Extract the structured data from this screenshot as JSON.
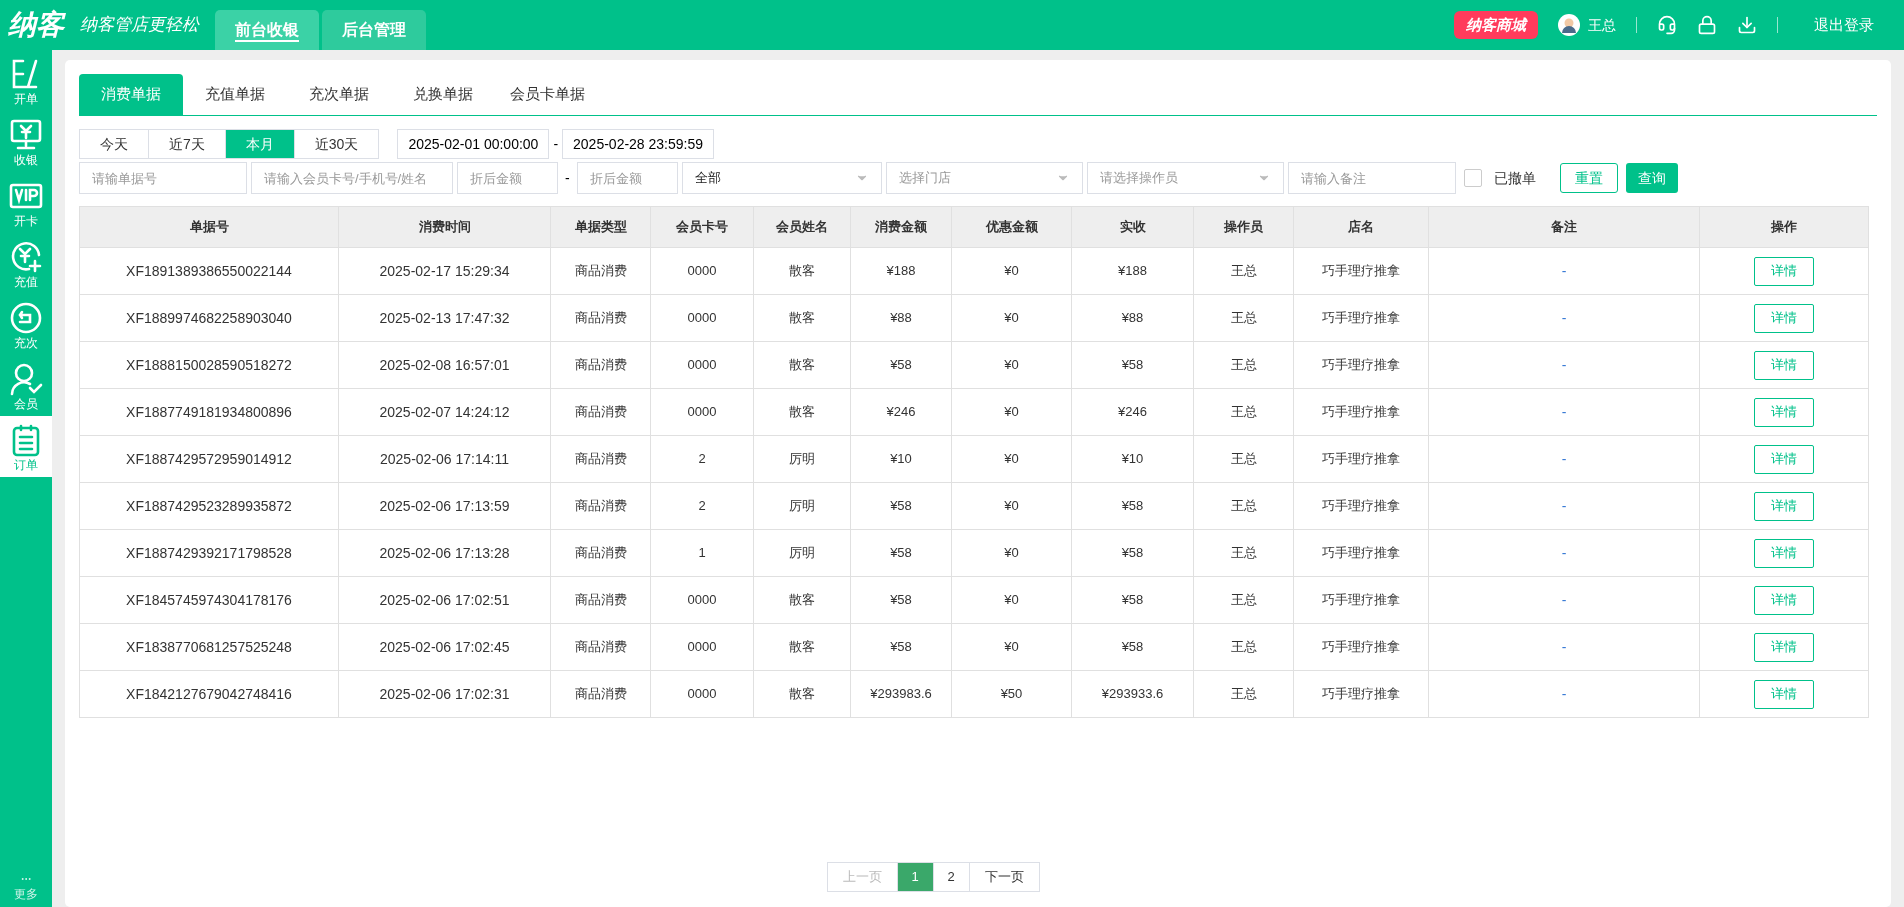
{
  "header": {
    "logo": "纳客",
    "slogan": "纳客管店更轻松",
    "nav": [
      {
        "label": "前台收银",
        "selected": true
      },
      {
        "label": "后台管理",
        "selected": false
      }
    ],
    "mall": "纳客商城",
    "user": "王总",
    "logout": "退出登录"
  },
  "sidebar": {
    "items": [
      {
        "label": "开单",
        "selected": false
      },
      {
        "label": "收银",
        "selected": false
      },
      {
        "label": "开卡",
        "selected": false
      },
      {
        "label": "充值",
        "selected": false
      },
      {
        "label": "充次",
        "selected": false
      },
      {
        "label": "会员",
        "selected": false
      },
      {
        "label": "订单",
        "selected": true
      }
    ],
    "more": "更多"
  },
  "tabs": [
    {
      "label": "消费单据",
      "selected": true
    },
    {
      "label": "充值单据",
      "selected": false
    },
    {
      "label": "充次单据",
      "selected": false
    },
    {
      "label": "兑换单据",
      "selected": false
    },
    {
      "label": "会员卡单据",
      "selected": false
    }
  ],
  "ranges": [
    {
      "label": "今天",
      "selected": false
    },
    {
      "label": "近7天",
      "selected": false
    },
    {
      "label": "本月",
      "selected": true
    },
    {
      "label": "近30天",
      "selected": false
    }
  ],
  "date_from": "2025-02-01 00:00:00",
  "date_sep": "-",
  "date_to": "2025-02-28 23:59:59",
  "filters": {
    "bill_no": {
      "placeholder": "请输单据号"
    },
    "member": {
      "placeholder": "请输入会员卡号/手机号/姓名"
    },
    "min_amount": {
      "placeholder": "折后金额"
    },
    "amount_sep": "-",
    "max_amount": {
      "placeholder": "折后金额"
    },
    "type": {
      "value": "全部"
    },
    "store": {
      "placeholder": "选择门店"
    },
    "operator": {
      "placeholder": "请选择操作员"
    },
    "note": {
      "placeholder": "请输入备注"
    },
    "revoked": {
      "label": "已撤单",
      "checked": false
    },
    "reset": "重置",
    "query": "查询"
  },
  "table": {
    "columns": [
      "单据号",
      "消费时间",
      "单据类型",
      "会员卡号",
      "会员姓名",
      "消费金额",
      "优惠金额",
      "实收",
      "操作员",
      "店名",
      "备注",
      "操作"
    ],
    "rows": [
      [
        "XF1891389386550022144",
        "2025-02-17 15:29:34",
        "商品消费",
        "0000",
        "散客",
        "¥188",
        "¥0",
        "¥188",
        "王总",
        "巧手理疗推拿",
        "-",
        "详情"
      ],
      [
        "XF1889974682258903040",
        "2025-02-13 17:47:32",
        "商品消费",
        "0000",
        "散客",
        "¥88",
        "¥0",
        "¥88",
        "王总",
        "巧手理疗推拿",
        "-",
        "详情"
      ],
      [
        "XF1888150028590518272",
        "2025-02-08 16:57:01",
        "商品消费",
        "0000",
        "散客",
        "¥58",
        "¥0",
        "¥58",
        "王总",
        "巧手理疗推拿",
        "-",
        "详情"
      ],
      [
        "XF1887749181934800896",
        "2025-02-07 14:24:12",
        "商品消费",
        "0000",
        "散客",
        "¥246",
        "¥0",
        "¥246",
        "王总",
        "巧手理疗推拿",
        "-",
        "详情"
      ],
      [
        "XF1887429572959014912",
        "2025-02-06 17:14:11",
        "商品消费",
        "2",
        "厉明",
        "¥10",
        "¥0",
        "¥10",
        "王总",
        "巧手理疗推拿",
        "-",
        "详情"
      ],
      [
        "XF1887429523289935872",
        "2025-02-06 17:13:59",
        "商品消费",
        "2",
        "厉明",
        "¥58",
        "¥0",
        "¥58",
        "王总",
        "巧手理疗推拿",
        "-",
        "详情"
      ],
      [
        "XF1887429392171798528",
        "2025-02-06 17:13:28",
        "商品消费",
        "1",
        "厉明",
        "¥58",
        "¥0",
        "¥58",
        "王总",
        "巧手理疗推拿",
        "-",
        "详情"
      ],
      [
        "XF1845745974304178176",
        "2025-02-06 17:02:51",
        "商品消费",
        "0000",
        "散客",
        "¥58",
        "¥0",
        "¥58",
        "王总",
        "巧手理疗推拿",
        "-",
        "详情"
      ],
      [
        "XF1838770681257525248",
        "2025-02-06 17:02:45",
        "商品消费",
        "0000",
        "散客",
        "¥58",
        "¥0",
        "¥58",
        "王总",
        "巧手理疗推拿",
        "-",
        "详情"
      ],
      [
        "XF1842127679042748416",
        "2025-02-06 17:02:31",
        "商品消费",
        "0000",
        "散客",
        "¥293983.6",
        "¥50",
        "¥293933.6",
        "王总",
        "巧手理疗推拿",
        "-",
        "详情"
      ]
    ]
  },
  "pagination": {
    "prev": {
      "label": "上一页",
      "disabled": true
    },
    "pages": [
      {
        "label": "1",
        "selected": true
      },
      {
        "label": "2",
        "selected": false
      }
    ],
    "next": {
      "label": "下一页",
      "disabled": false
    }
  }
}
